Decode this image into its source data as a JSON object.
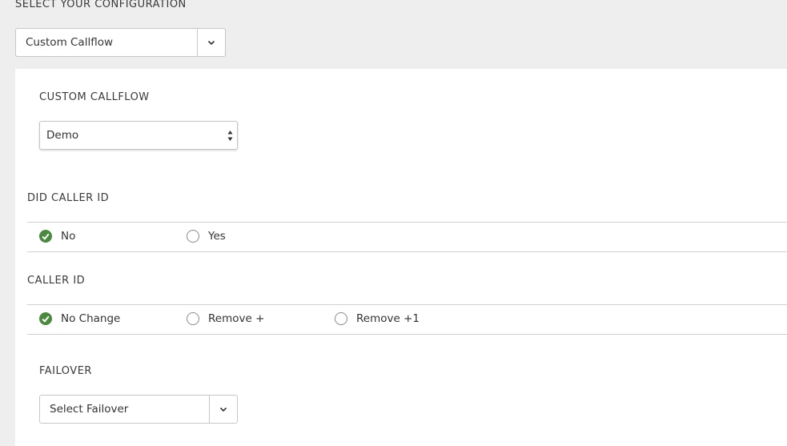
{
  "configuration": {
    "label": "SELECT YOUR CONFIGURATION",
    "selected": "Custom Callflow"
  },
  "custom_callflow": {
    "label": "CUSTOM CALLFLOW",
    "selected": "Demo"
  },
  "did_caller_id": {
    "label": "DID CALLER ID",
    "options": [
      {
        "label": "No",
        "checked": true
      },
      {
        "label": "Yes",
        "checked": false
      }
    ]
  },
  "caller_id": {
    "label": "CALLER ID",
    "options": [
      {
        "label": "No Change",
        "checked": true
      },
      {
        "label": "Remove +",
        "checked": false
      },
      {
        "label": "Remove +1",
        "checked": false
      }
    ]
  },
  "failover": {
    "label": "FAILOVER",
    "selected": "Select Failover"
  },
  "colors": {
    "background": "#eeeeee",
    "panel": "#ffffff",
    "radio_checked": "#4a8a3e",
    "border": "#c6c6c6"
  }
}
